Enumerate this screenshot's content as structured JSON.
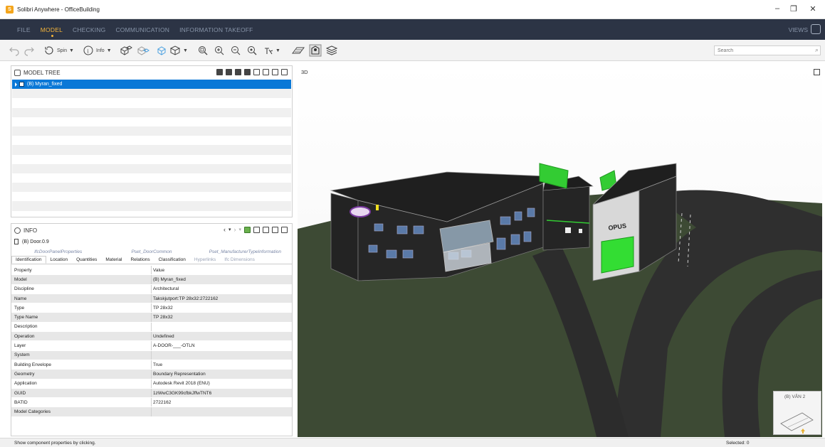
{
  "window": {
    "app_icon_letter": "S",
    "title": "Solibri Anywhere - OfficeBuilding",
    "minimize": "–",
    "restore": "❐",
    "close": "✕"
  },
  "menu": {
    "items": [
      {
        "label": "FILE"
      },
      {
        "label": "MODEL"
      },
      {
        "label": "CHECKING"
      },
      {
        "label": "COMMUNICATION"
      },
      {
        "label": "INFORMATION TAKEOFF"
      }
    ],
    "active": "MODEL",
    "views_label": "VIEWS"
  },
  "toolbar": {
    "spin_label": "Spin",
    "info_label": "Info",
    "search_placeholder": "Search"
  },
  "model_tree": {
    "title": "MODEL TREE",
    "rows": [
      "(B) Myran_fixed"
    ]
  },
  "info": {
    "title": "INFO",
    "selected_item": "(B) Door.0.9",
    "psets": [
      "IfcDoorPanelProperties",
      "Pset_DoorCommon",
      "Pset_ManufacturerTypeInformation"
    ],
    "tabs": [
      {
        "label": "Identification",
        "state": "active"
      },
      {
        "label": "Location",
        "state": "normal"
      },
      {
        "label": "Quantities",
        "state": "normal"
      },
      {
        "label": "Material",
        "state": "normal"
      },
      {
        "label": "Relations",
        "state": "normal"
      },
      {
        "label": "Classification",
        "state": "normal"
      },
      {
        "label": "Hyperlinks",
        "state": "grey"
      },
      {
        "label": "Ifc Dimensions",
        "state": "grey"
      }
    ],
    "header": {
      "key": "Property",
      "value": "Value"
    },
    "properties": [
      {
        "key": "Model",
        "value": "(B) Myran_fixed"
      },
      {
        "key": "Discipline",
        "value": "Architectural"
      },
      {
        "key": "Name",
        "value": "Takskjutport:TP 28x32:2722162"
      },
      {
        "key": "Type",
        "value": "TP 28x32"
      },
      {
        "key": "Type Name",
        "value": "TP 28x32"
      },
      {
        "key": "Description",
        "value": ""
      },
      {
        "key": "Operation",
        "value": "Undefined"
      },
      {
        "key": "Layer",
        "value": "A-DOOR-___-OTLN"
      },
      {
        "key": "System",
        "value": ""
      },
      {
        "key": "Building Envelope",
        "value": "True"
      },
      {
        "key": "Geometry",
        "value": "Boundary Representation"
      },
      {
        "key": "Application",
        "value": "Autodesk Revit 2018 (ENU)"
      },
      {
        "key": "GUID",
        "value": "1zWwC3GK99cfbkJffwTNT6"
      },
      {
        "key": "BATID",
        "value": "2722162"
      },
      {
        "key": "Model Categories",
        "value": ""
      }
    ]
  },
  "viewport": {
    "label": "3D",
    "sign_text": "OPUS",
    "minimap_label": "(B) VÅN 2",
    "colors": {
      "ground": "#3d4a34",
      "road": "#2f2f2f",
      "roof": "#202020",
      "highlight": "#33dd33"
    }
  },
  "status": {
    "hint": "Show component properties by clicking.",
    "selected": "Selected: 0"
  }
}
